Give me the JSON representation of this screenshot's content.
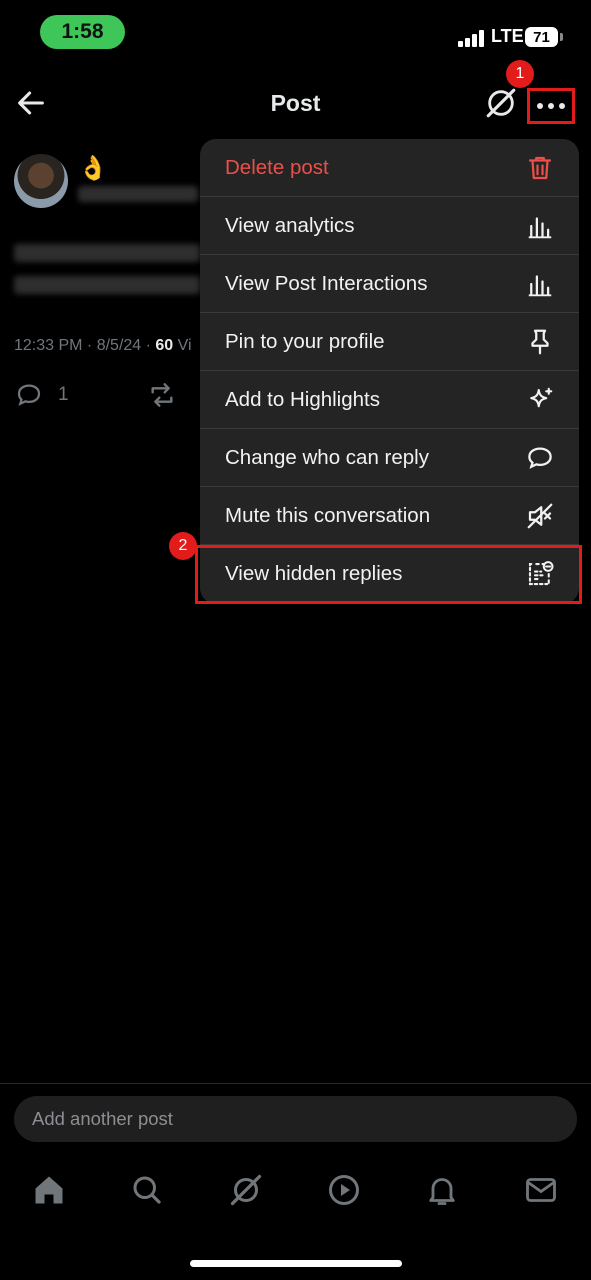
{
  "status_bar": {
    "time": "1:58",
    "network": "LTE",
    "battery": "71"
  },
  "nav": {
    "title": "Post",
    "back_icon": "arrow-left-icon",
    "grok_icon": "grok-icon",
    "more_icon": "ellipsis-icon"
  },
  "annotations": {
    "badge_1": "1",
    "badge_2": "2"
  },
  "post": {
    "timestamp": "12:33 PM · 8/5/24 · ",
    "views_count": "60",
    "views_suffix": " Vi",
    "reply_count": "1"
  },
  "menu": {
    "items": [
      {
        "label": "Delete post",
        "icon": "trash-icon",
        "destructive": true
      },
      {
        "label": "View analytics",
        "icon": "analytics-icon"
      },
      {
        "label": "View Post Interactions",
        "icon": "analytics-icon"
      },
      {
        "label": "Pin to your profile",
        "icon": "pin-icon"
      },
      {
        "label": "Add to Highlights",
        "icon": "sparkle-icon"
      },
      {
        "label": "Change who can reply",
        "icon": "speech-bubble-icon"
      },
      {
        "label": "Mute this conversation",
        "icon": "mute-icon"
      },
      {
        "label": "View hidden replies",
        "icon": "hidden-replies-icon"
      }
    ]
  },
  "composer": {
    "placeholder": "Add another post"
  },
  "tabs": [
    "home-icon",
    "search-icon",
    "grok-icon",
    "video-icon",
    "bell-icon",
    "mail-icon"
  ],
  "colors": {
    "danger": "#ec4f4a",
    "annotation": "#e21b1b",
    "menu_bg": "#242424",
    "status_pill": "#3ec659"
  }
}
